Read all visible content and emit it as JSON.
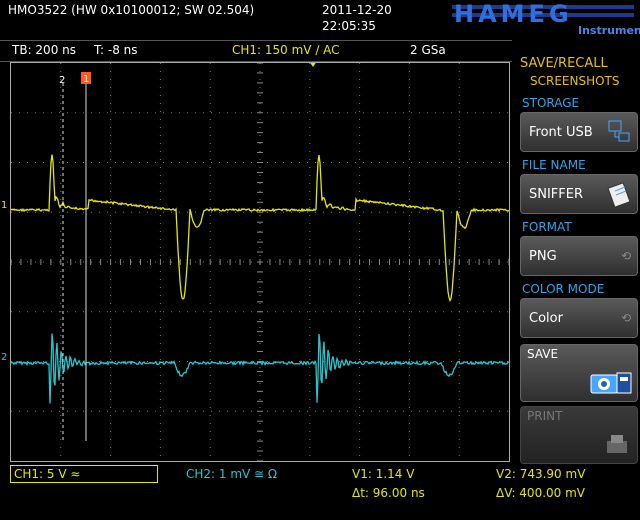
{
  "header": {
    "model": "HMO3522 (HW 0x10100012; SW 02.504)",
    "date": "2011-12-20",
    "time": "22:05:35",
    "brand": "HAMEG",
    "brand_sub": "Instruments"
  },
  "status": {
    "timebase": "TB: 200 ns",
    "trigger_time": "T: -8 ns",
    "ch1_setting": "CH1: 150 mV ∕ AC",
    "sample_rate": "2 GSa"
  },
  "menu": {
    "title_line1": "SAVE/RECALL",
    "title_line2": "SCREENSHOTS",
    "storage_label": "STORAGE",
    "storage_value": "Front USB",
    "filename_label": "FILE NAME",
    "filename_value": "SNIFFER",
    "format_label": "FORMAT",
    "format_value": "PNG",
    "colormode_label": "COLOR MODE",
    "colormode_value": "Color",
    "save_label": "SAVE",
    "print_label": "PRINT"
  },
  "markers": {
    "cursor1": "1",
    "cursor2": "2",
    "ch1_ref": "1",
    "ch2_ref": "2"
  },
  "bottom": {
    "ch1": "CH1: 5 V ≈",
    "ch2": "CH2: 1 mV ≅ Ω",
    "v1": "V1: 1.14 V",
    "delta_t": "Δt: 96.00 ns",
    "v2": "V2: 743.90 mV",
    "delta_v": "ΔV: 400.00 mV"
  },
  "colors": {
    "ch1": "#e6e600",
    "ch2": "#22c8d0",
    "menu_heading": "#2fa6e6",
    "trigger_marker": "#ff5a1e"
  }
}
